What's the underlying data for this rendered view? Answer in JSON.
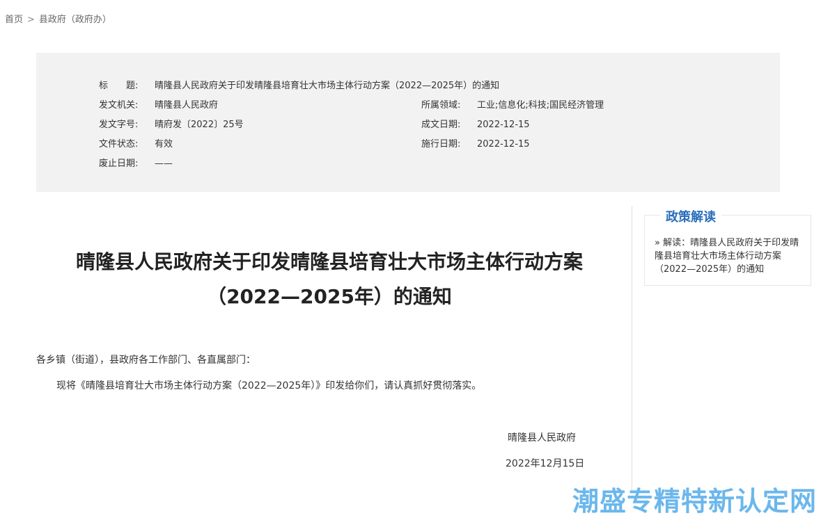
{
  "breadcrumb": {
    "home": "首页",
    "separator": ">",
    "current": "县政府（政府办）"
  },
  "meta": {
    "title_label": "标　　题:",
    "title_value": "晴隆县人民政府关于印发晴隆县培育壮大市场主体行动方案（2022—2025年）的通知",
    "issuer_label": "发文机关:",
    "issuer_value": "晴隆县人民政府",
    "field_label": "所属领域:",
    "field_value": "工业;信息化;科技;国民经济管理",
    "docno_label": "发文字号:",
    "docno_value": "晴府发〔2022〕25号",
    "written_label": "成文日期:",
    "written_value": "2022-12-15",
    "status_label": "文件状态:",
    "status_value": "有效",
    "effective_label": "施行日期:",
    "effective_value": "2022-12-15",
    "abolish_label": "废止日期:",
    "abolish_value": "——"
  },
  "document": {
    "title_line1": "晴隆县人民政府关于印发晴隆县培育壮大市场主体行动方案",
    "title_line2": "（2022—2025年）的通知",
    "salutation": "各乡镇（街道），县政府各工作部门、各直属部门：",
    "body": "现将《晴隆县培育壮大市场主体行动方案（2022—2025年）》印发给你们，请认真抓好贯彻落实。",
    "signature": "晴隆县人民政府",
    "date": "2022年12月15日"
  },
  "sidebar": {
    "title": "政策解读",
    "link": "» 解读：晴隆县人民政府关于印发晴隆县培育壮大市场主体行动方案（2022—2025年）的通知"
  },
  "watermark": "潮盛专精特新认定网",
  "colors": {
    "accent": "#2a6ebb",
    "meta_bg": "#f2f2f2",
    "watermark": "#3aa0e6"
  }
}
